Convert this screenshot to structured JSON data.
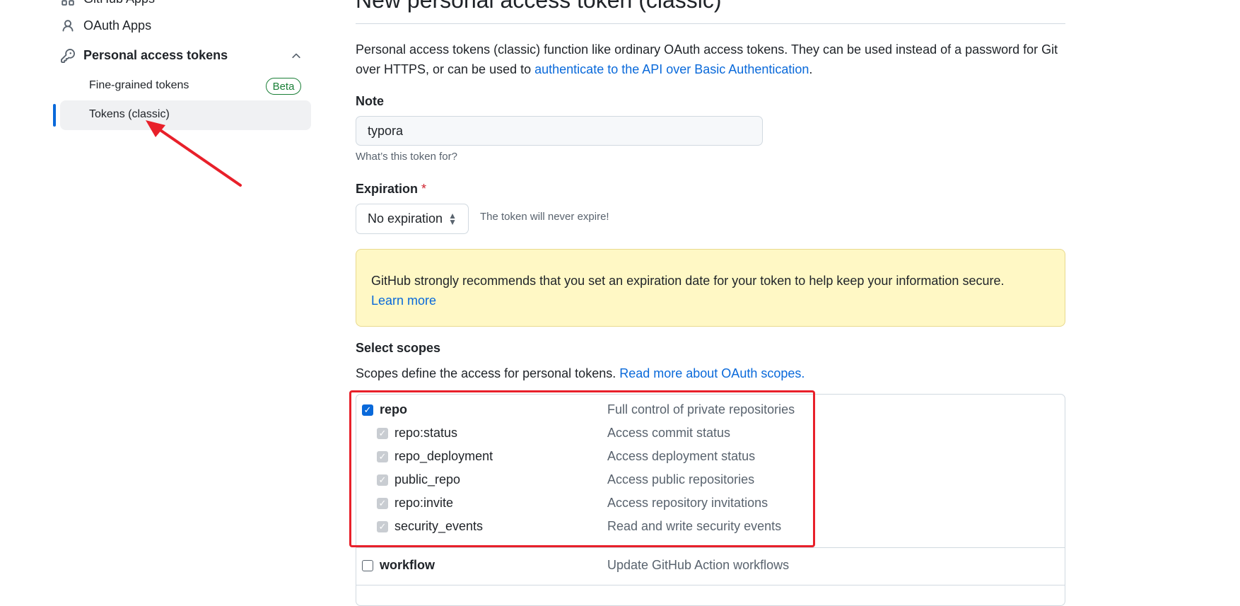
{
  "sidebar": {
    "github_apps_label": "GitHub Apps",
    "oauth_apps_label": "OAuth Apps",
    "personal_tokens_label": "Personal access tokens",
    "fine_grained_label": "Fine-grained tokens",
    "beta_badge": "Beta",
    "classic_label": "Tokens (classic)"
  },
  "main": {
    "title": "New personal access token (classic)",
    "intro_text": "Personal access tokens (classic) function like ordinary OAuth access tokens. They can be used instead of a password for Git over HTTPS, or can be used to ",
    "intro_link": "authenticate to the API over Basic Authentication",
    "intro_end": ".",
    "note_label": "Note",
    "note_value": "typora",
    "note_hint": "What’s this token for?",
    "expiration_label": "Expiration",
    "required_mark": "*",
    "expiration_value": "No expiration",
    "expiration_hint": "The token will never expire!",
    "warning_text": "GitHub strongly recommends that you set an expiration date for your token to help keep your information secure.",
    "warning_link": "Learn more",
    "scopes_label": "Select scopes",
    "scopes_desc": "Scopes define the access for personal tokens. ",
    "scopes_link": "Read more about OAuth scopes."
  },
  "scopes": [
    {
      "name": "repo",
      "desc": "Full control of private repositories",
      "checked": true,
      "child": false
    },
    {
      "name": "repo:status",
      "desc": "Access commit status",
      "checked": true,
      "child": true
    },
    {
      "name": "repo_deployment",
      "desc": "Access deployment status",
      "checked": true,
      "child": true
    },
    {
      "name": "public_repo",
      "desc": "Access public repositories",
      "checked": true,
      "child": true
    },
    {
      "name": "repo:invite",
      "desc": "Access repository invitations",
      "checked": true,
      "child": true
    },
    {
      "name": "security_events",
      "desc": "Read and write security events",
      "checked": true,
      "child": true
    },
    {
      "name": "workflow",
      "desc": "Update GitHub Action workflows",
      "checked": false,
      "child": false
    }
  ],
  "colors": {
    "accent": "#0969da",
    "annotation_red": "#e8202a",
    "warning_bg": "#fff8c5",
    "beta_green": "#1a7f37"
  }
}
